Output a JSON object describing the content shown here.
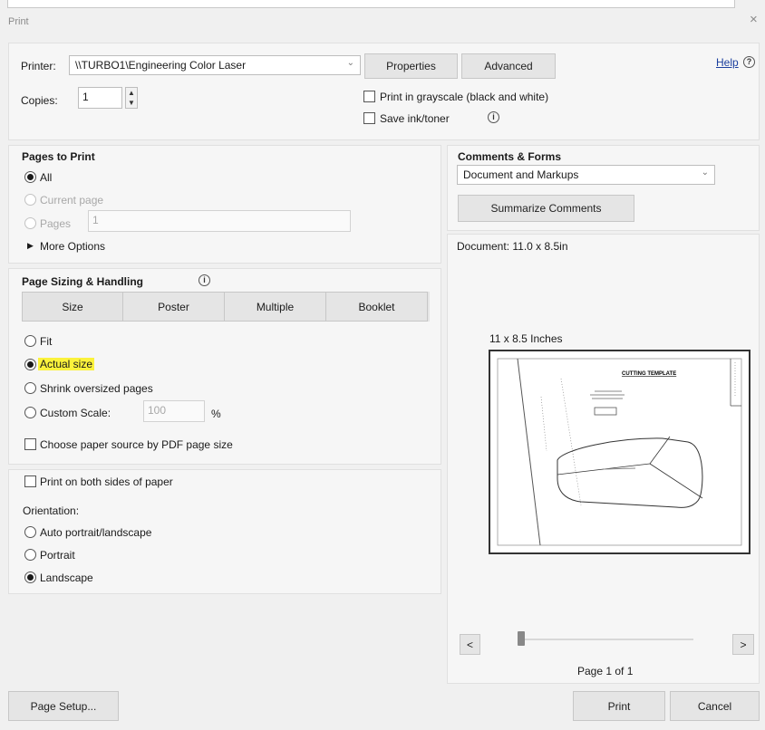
{
  "window": {
    "title": "Print",
    "close_glyph": "×"
  },
  "printer": {
    "label": "Printer:",
    "value": "\\\\TURBO1\\Engineering Color Laser",
    "properties_label": "Properties",
    "advanced_label": "Advanced",
    "help_label": "Help"
  },
  "copies": {
    "label": "Copies:",
    "value": "1"
  },
  "options": {
    "grayscale_label": "Print in grayscale (black and white)",
    "save_ink_label": "Save ink/toner"
  },
  "pages_to_print": {
    "heading": "Pages to Print",
    "all_label": "All",
    "current_label": "Current page",
    "pages_label": "Pages",
    "pages_value": "1",
    "more_options_label": "More Options"
  },
  "sizing": {
    "heading": "Page Sizing & Handling",
    "tabs": [
      "Size",
      "Poster",
      "Multiple",
      "Booklet"
    ],
    "fit_label": "Fit",
    "actual_label": "Actual size",
    "shrink_label": "Shrink oversized pages",
    "custom_label": "Custom Scale:",
    "custom_value": "100",
    "percent": "%",
    "paper_source_label": "Choose paper source by PDF page size"
  },
  "duplex": {
    "both_sides_label": "Print on both sides of paper",
    "orientation_label": "Orientation:",
    "auto_label": "Auto portrait/landscape",
    "portrait_label": "Portrait",
    "landscape_label": "Landscape"
  },
  "comments": {
    "heading": "Comments & Forms",
    "value": "Document and Markups",
    "summarize_label": "Summarize Comments"
  },
  "preview": {
    "doc_size": "Document: 11.0 x 8.5in",
    "page_dims": "11 x 8.5 Inches",
    "template_title": "CUTTING TEMPLATE",
    "page_counter": "Page 1 of 1",
    "prev_glyph": "<",
    "next_glyph": ">"
  },
  "footer": {
    "page_setup_label": "Page Setup...",
    "print_label": "Print",
    "cancel_label": "Cancel"
  },
  "colors": {
    "highlight": "#fbf23c",
    "link": "#1b3f9e"
  }
}
